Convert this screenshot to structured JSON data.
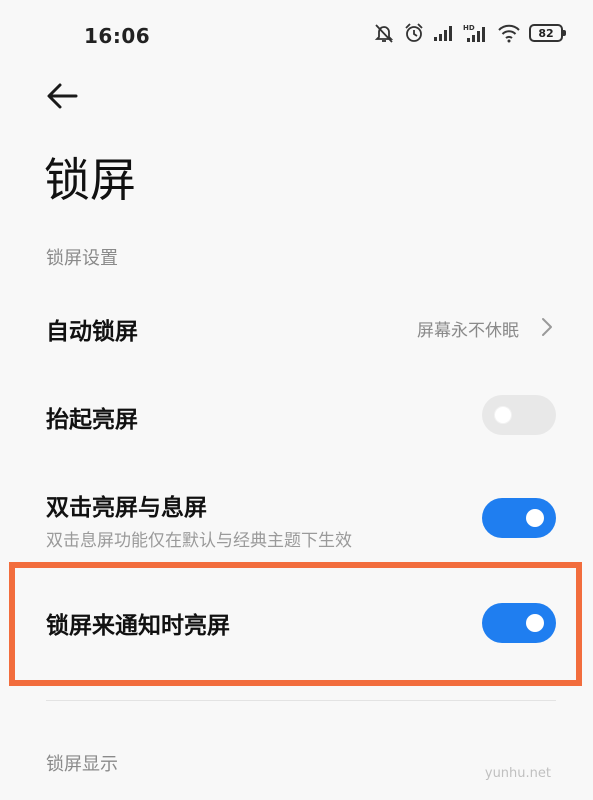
{
  "status_bar": {
    "time": "16:06",
    "battery": "82",
    "icons": [
      "mute-bell-icon",
      "alarm-icon",
      "signal-icon",
      "hd-signal-icon",
      "wifi-icon",
      "battery-icon"
    ]
  },
  "header": {
    "back_icon": "arrow-left-icon",
    "title": "锁屏"
  },
  "sections": {
    "lock_settings": "锁屏设置",
    "lock_display": "锁屏显示"
  },
  "rows": {
    "auto_lock": {
      "title": "自动锁屏",
      "value": "屏幕永不休眠"
    },
    "raise_to_wake": {
      "title": "抬起亮屏",
      "enabled": false
    },
    "double_tap": {
      "title": "双击亮屏与息屏",
      "subtitle": "双击息屏功能仅在默认与经典主题下生效",
      "enabled": true
    },
    "notification_wake": {
      "title": "锁屏来通知时亮屏",
      "enabled": true
    }
  },
  "colors": {
    "toggle_on": "#1f7ef0",
    "toggle_off": "#e8e8e8",
    "highlight": "#f26d3d"
  },
  "watermark": "yunhu.net"
}
